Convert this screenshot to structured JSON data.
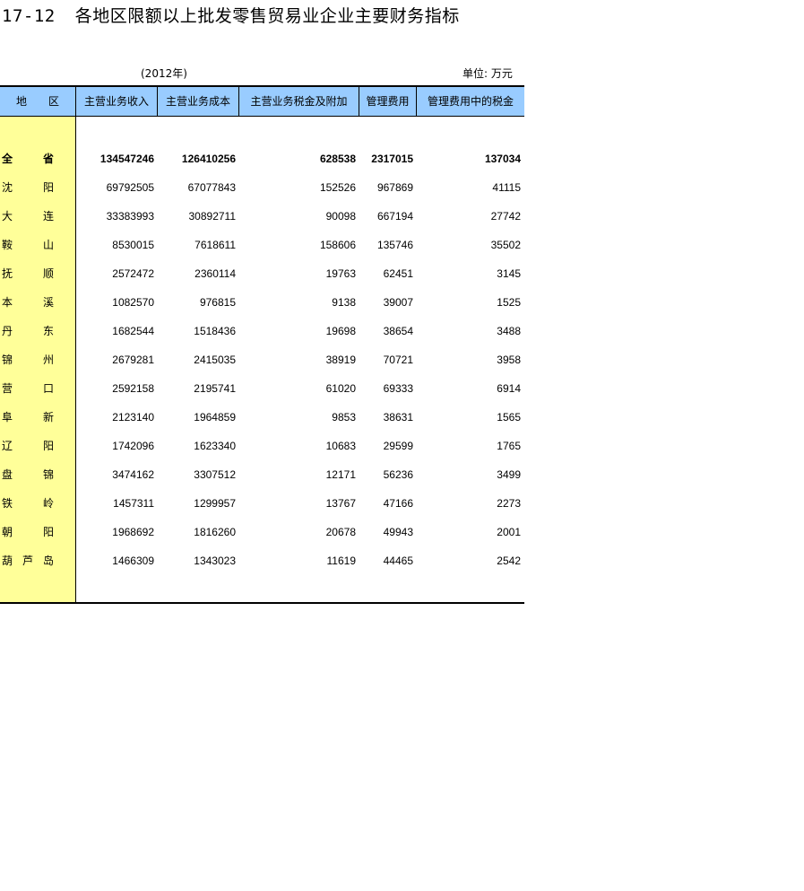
{
  "title": {
    "number": "17-12",
    "text": "各地区限额以上批发零售贸易业企业主要财务指标"
  },
  "year": "(2012年)",
  "unit": "单位: 万元",
  "headers": [
    "地　　区",
    "主营业务收入",
    "主营业务成本",
    "主营业务税金及附加",
    "管理费用",
    "管理费用中的税金"
  ],
  "rows": [
    {
      "region": [
        "全",
        "省"
      ],
      "income": "134547246",
      "cost": "126410256",
      "tax": "628538",
      "mgmt": "2317015",
      "mgmt_tax": "137034"
    },
    {
      "region": [
        "沈",
        "阳"
      ],
      "income": "69792505",
      "cost": "67077843",
      "tax": "152526",
      "mgmt": "967869",
      "mgmt_tax": "41115"
    },
    {
      "region": [
        "大",
        "连"
      ],
      "income": "33383993",
      "cost": "30892711",
      "tax": "90098",
      "mgmt": "667194",
      "mgmt_tax": "27742"
    },
    {
      "region": [
        "鞍",
        "山"
      ],
      "income": "8530015",
      "cost": "7618611",
      "tax": "158606",
      "mgmt": "135746",
      "mgmt_tax": "35502"
    },
    {
      "region": [
        "抚",
        "顺"
      ],
      "income": "2572472",
      "cost": "2360114",
      "tax": "19763",
      "mgmt": "62451",
      "mgmt_tax": "3145"
    },
    {
      "region": [
        "本",
        "溪"
      ],
      "income": "1082570",
      "cost": "976815",
      "tax": "9138",
      "mgmt": "39007",
      "mgmt_tax": "1525"
    },
    {
      "region": [
        "丹",
        "东"
      ],
      "income": "1682544",
      "cost": "1518436",
      "tax": "19698",
      "mgmt": "38654",
      "mgmt_tax": "3488"
    },
    {
      "region": [
        "锦",
        "州"
      ],
      "income": "2679281",
      "cost": "2415035",
      "tax": "38919",
      "mgmt": "70721",
      "mgmt_tax": "3958"
    },
    {
      "region": [
        "营",
        "口"
      ],
      "income": "2592158",
      "cost": "2195741",
      "tax": "61020",
      "mgmt": "69333",
      "mgmt_tax": "6914"
    },
    {
      "region": [
        "阜",
        "新"
      ],
      "income": "2123140",
      "cost": "1964859",
      "tax": "9853",
      "mgmt": "38631",
      "mgmt_tax": "1565"
    },
    {
      "region": [
        "辽",
        "阳"
      ],
      "income": "1742096",
      "cost": "1623340",
      "tax": "10683",
      "mgmt": "29599",
      "mgmt_tax": "1765"
    },
    {
      "region": [
        "盘",
        "锦"
      ],
      "income": "3474162",
      "cost": "3307512",
      "tax": "12171",
      "mgmt": "56236",
      "mgmt_tax": "3499"
    },
    {
      "region": [
        "铁",
        "岭"
      ],
      "income": "1457311",
      "cost": "1299957",
      "tax": "13767",
      "mgmt": "47166",
      "mgmt_tax": "2273"
    },
    {
      "region": [
        "朝",
        "阳"
      ],
      "income": "1968692",
      "cost": "1816260",
      "tax": "20678",
      "mgmt": "49943",
      "mgmt_tax": "2001"
    },
    {
      "region": [
        "葫",
        "芦",
        "岛"
      ],
      "income": "1466309",
      "cost": "1343023",
      "tax": "11619",
      "mgmt": "44465",
      "mgmt_tax": "2542"
    }
  ]
}
